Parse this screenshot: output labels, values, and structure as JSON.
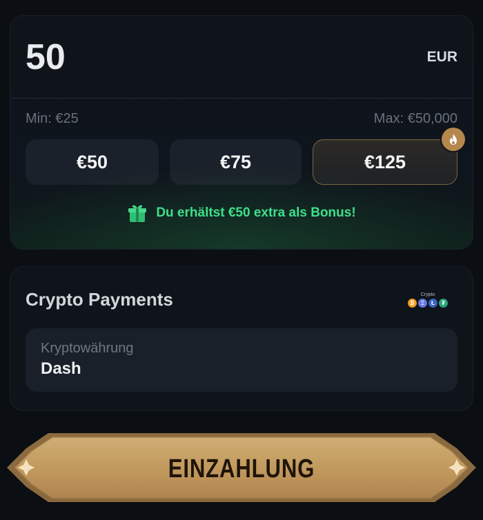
{
  "amount": {
    "value": "50",
    "currency": "EUR",
    "min_label": "Min: €25",
    "max_label": "Max: €50,000"
  },
  "presets": [
    {
      "label": "€50",
      "selected": false,
      "hot": false
    },
    {
      "label": "€75",
      "selected": false,
      "hot": false
    },
    {
      "label": "€125",
      "selected": true,
      "hot": true
    }
  ],
  "bonus": {
    "text": "Du erhältst €50 extra als Bonus!",
    "icon": "gift-icon",
    "color": "#3ee08a"
  },
  "crypto": {
    "title": "Crypto Payments",
    "logo_text": "Crypto",
    "coin_icons": [
      "bitcoin-icon",
      "ethereum-icon",
      "litecoin-icon",
      "tether-icon"
    ],
    "field_label": "Kryptowährung",
    "field_value": "Dash"
  },
  "deposit": {
    "label": "EINZAHLUNG",
    "color": "#c9a467"
  },
  "colors": {
    "background": "#0b0e12",
    "card": "#0f141b",
    "accent_gold": "#b5874c"
  }
}
